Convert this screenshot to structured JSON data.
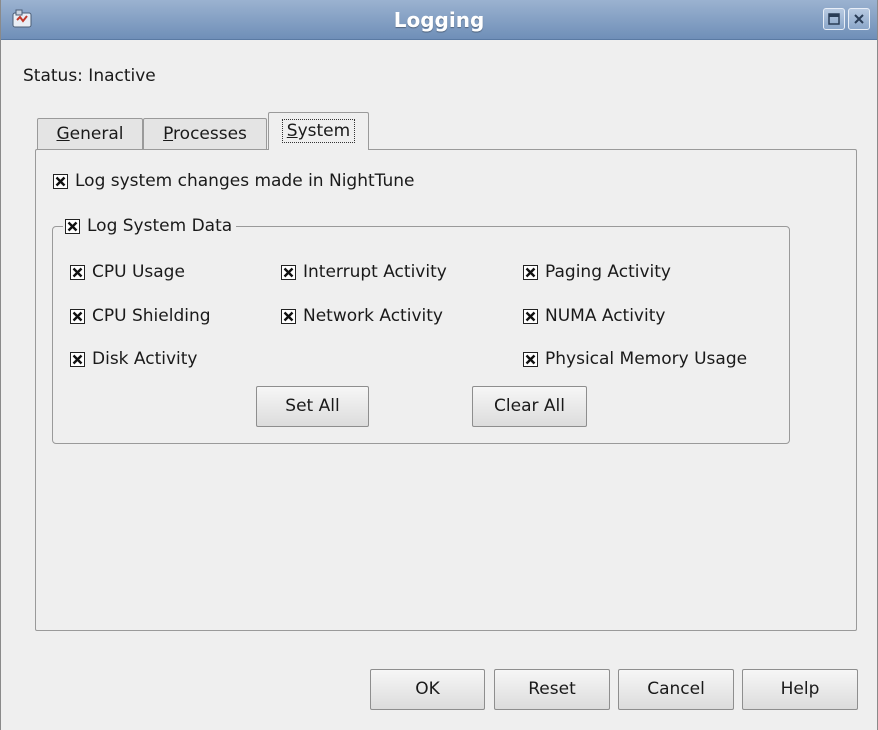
{
  "window": {
    "title": "Logging",
    "app_icon": "app-icon",
    "controls": [
      "maximize-icon",
      "close-icon"
    ]
  },
  "status": {
    "text": "Status: Inactive"
  },
  "tabs": [
    {
      "label": "General",
      "mnemonic": "G",
      "rest": "eneral",
      "active": false
    },
    {
      "label": "Processes",
      "mnemonic": "P",
      "rest": "rocesses",
      "active": false
    },
    {
      "label": "System",
      "mnemonic": "S",
      "rest": "ystem",
      "active": true
    }
  ],
  "system_tab": {
    "log_changes": {
      "label": "Log system changes made in NightTune",
      "checked": true
    },
    "log_system_data": {
      "label": "Log System Data",
      "checked": true
    },
    "items": [
      {
        "label": "CPU Usage",
        "checked": true
      },
      {
        "label": "Interrupt Activity",
        "checked": true
      },
      {
        "label": "Paging Activity",
        "checked": true
      },
      {
        "label": "CPU Shielding",
        "checked": true
      },
      {
        "label": "Network Activity",
        "checked": true
      },
      {
        "label": "NUMA Activity",
        "checked": true
      },
      {
        "label": "Disk Activity",
        "checked": true
      },
      {
        "label": "Physical Memory Usage",
        "checked": true
      }
    ],
    "set_all_label": "Set All",
    "clear_all_label": "Clear All"
  },
  "dialog_buttons": {
    "ok": "OK",
    "reset": "Reset",
    "cancel": "Cancel",
    "help": "Help"
  },
  "colors": {
    "titlebar": "#7f9cc2",
    "window_bg": "#efefef"
  }
}
